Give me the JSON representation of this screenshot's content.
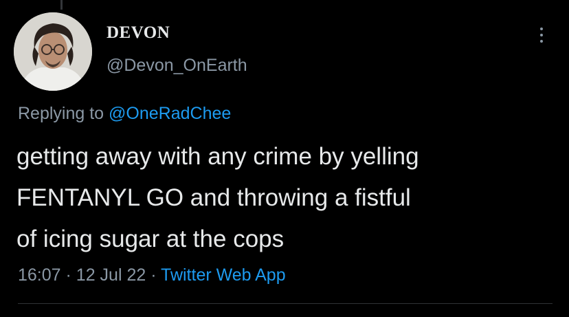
{
  "tweet": {
    "author": {
      "display_name": "DEVON",
      "handle": "@Devon_OnEarth"
    },
    "reply": {
      "prefix": "Replying to",
      "mention": "@OneRadChee"
    },
    "text_lines": [
      "getting away with any crime by yelling",
      "FENTANYL GO and throwing a fistful",
      "of icing sugar at the cops"
    ],
    "meta": {
      "time": "16:07",
      "separator": "·",
      "date": "12 Jul 22",
      "source": "Twitter Web App"
    }
  },
  "icons": {
    "more": "more-options-icon",
    "avatar": "profile-photo"
  },
  "colors": {
    "background": "#000000",
    "primary_text": "#e7e9ea",
    "secondary_text": "#8b98a5",
    "link": "#1d9bf0",
    "divider": "#2f3336"
  }
}
